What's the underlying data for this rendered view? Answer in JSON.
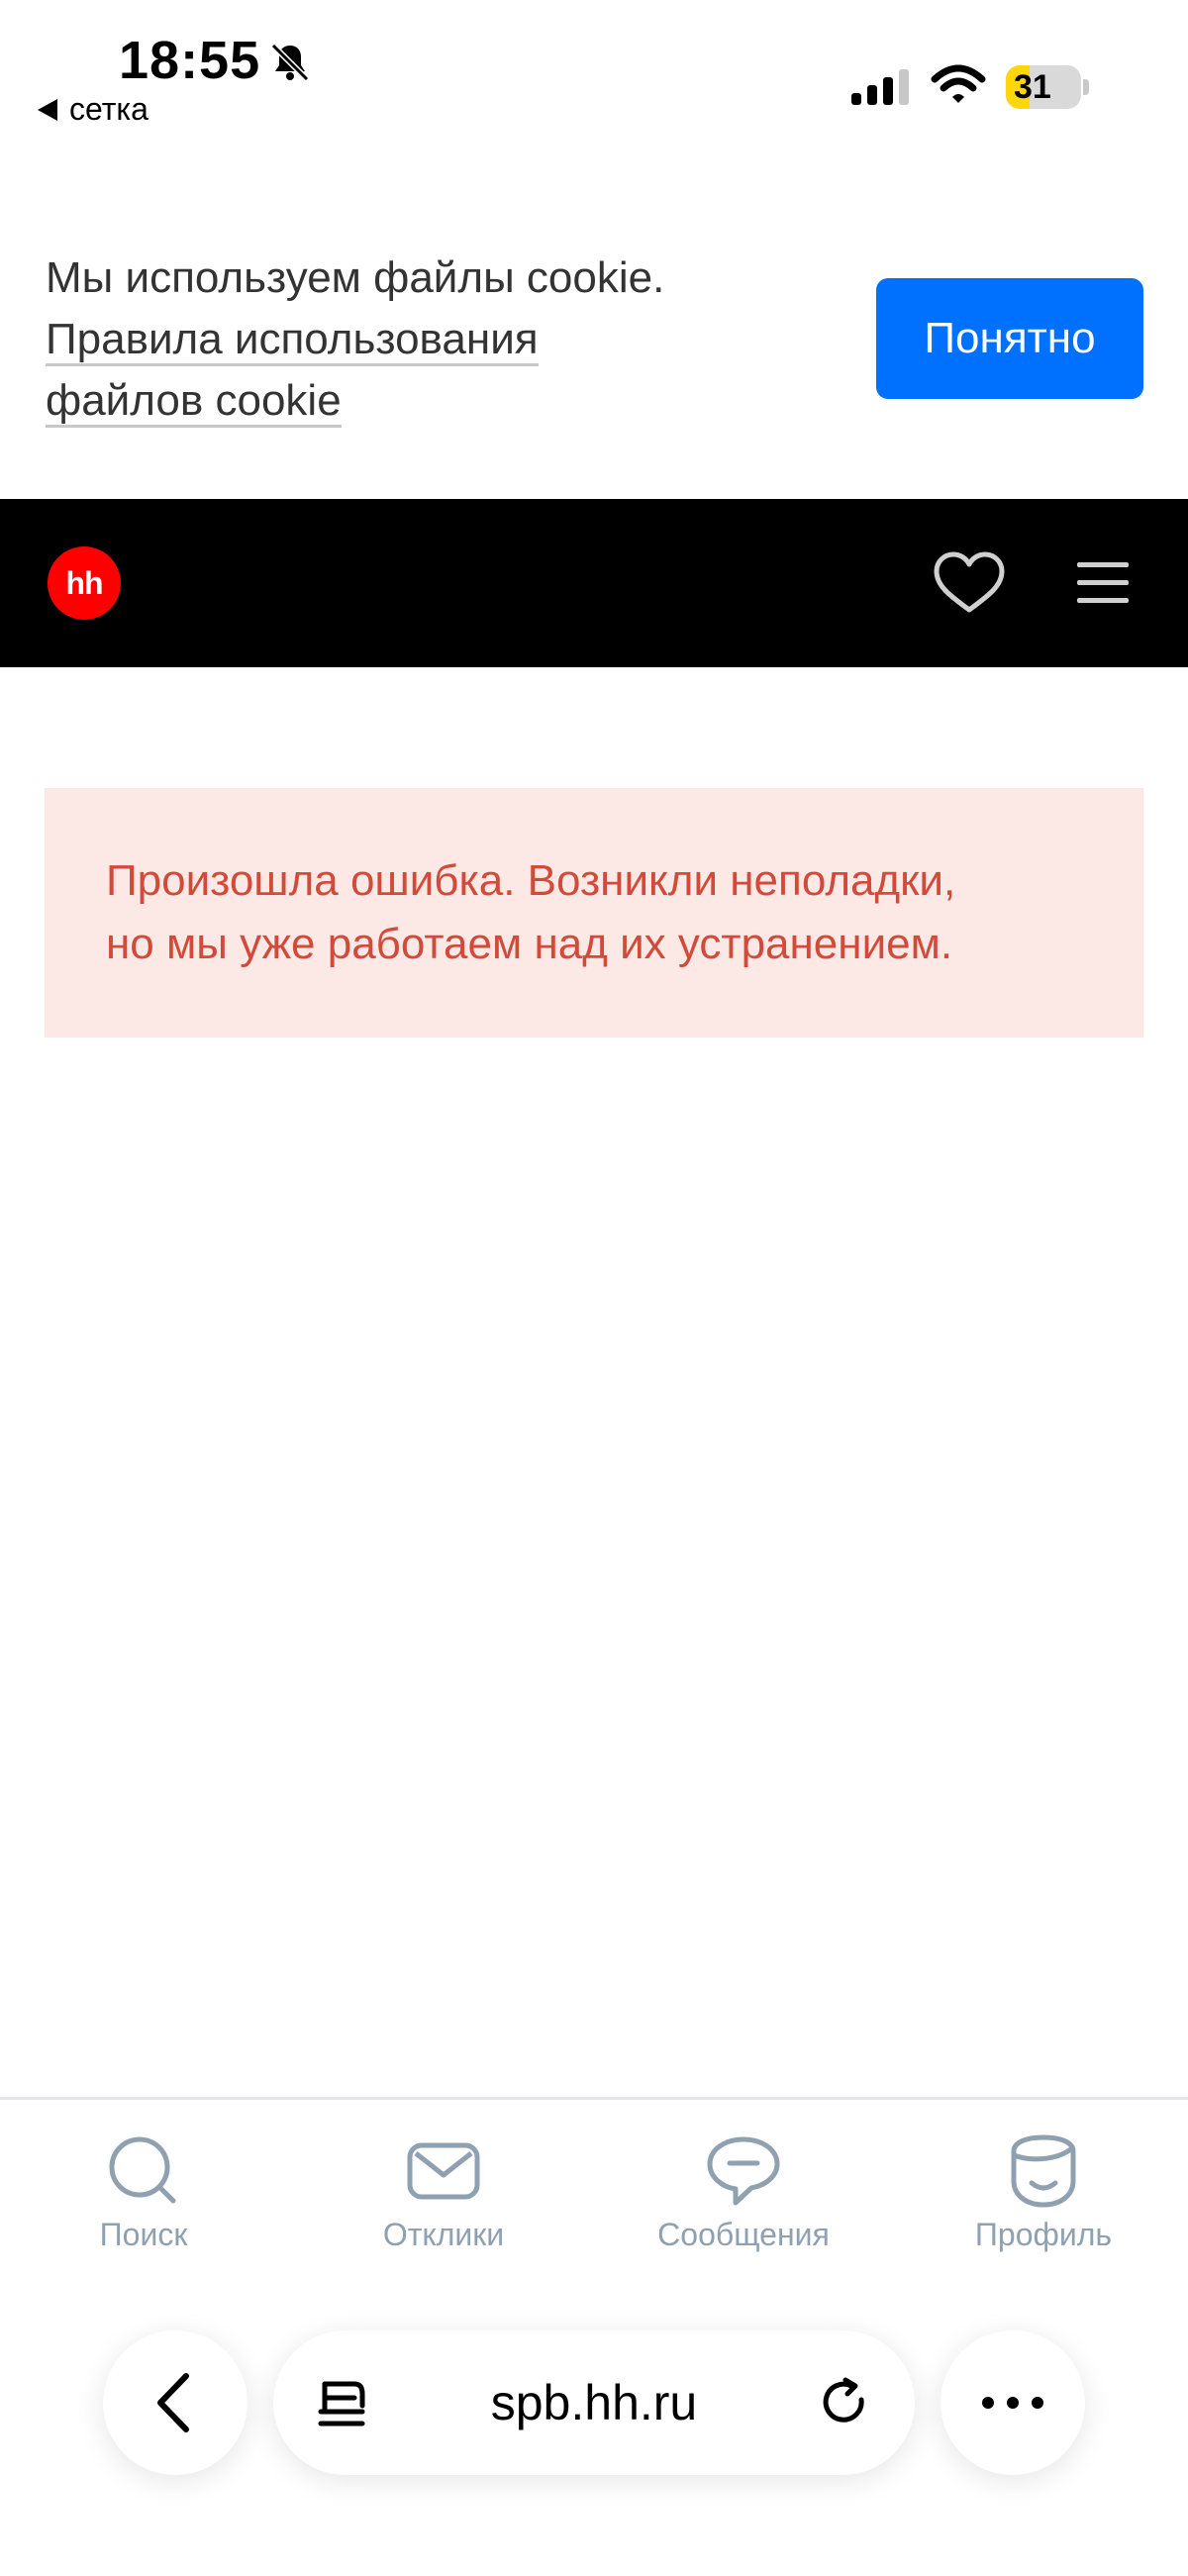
{
  "status_bar": {
    "time": "18:55",
    "back_app": "сетка",
    "battery_percent": 31,
    "battery_label": "31",
    "battery_color": "#ffd60a"
  },
  "cookie_banner": {
    "text": "Мы используем файлы cookie.",
    "link_line1": "Правила использования",
    "link_line2": "файлов cookie",
    "button": "Понятно"
  },
  "header": {
    "logo": "hh",
    "logo_color": "#ff0000",
    "icons": [
      "heart-icon",
      "hamburger-menu-icon"
    ]
  },
  "error": {
    "line1": "Произошла ошибка. Возникли неполадки,",
    "line2": "но мы уже работаем над их устранением.",
    "text_color": "#d14a3a",
    "background": "#fce9e6"
  },
  "tabbar": {
    "items": [
      {
        "label": "Поиск",
        "icon": "search-icon"
      },
      {
        "label": "Отклики",
        "icon": "mail-icon"
      },
      {
        "label": "Сообщения",
        "icon": "chat-bubble-icon"
      },
      {
        "label": "Профиль",
        "icon": "profile-face-icon"
      }
    ],
    "color": "#8fa0b0"
  },
  "browser": {
    "url": "spb.hh.ru",
    "icons": [
      "back-chevron-icon",
      "reader-icon",
      "reload-icon",
      "more-dots-icon"
    ]
  },
  "accent_color": "#0070ff"
}
